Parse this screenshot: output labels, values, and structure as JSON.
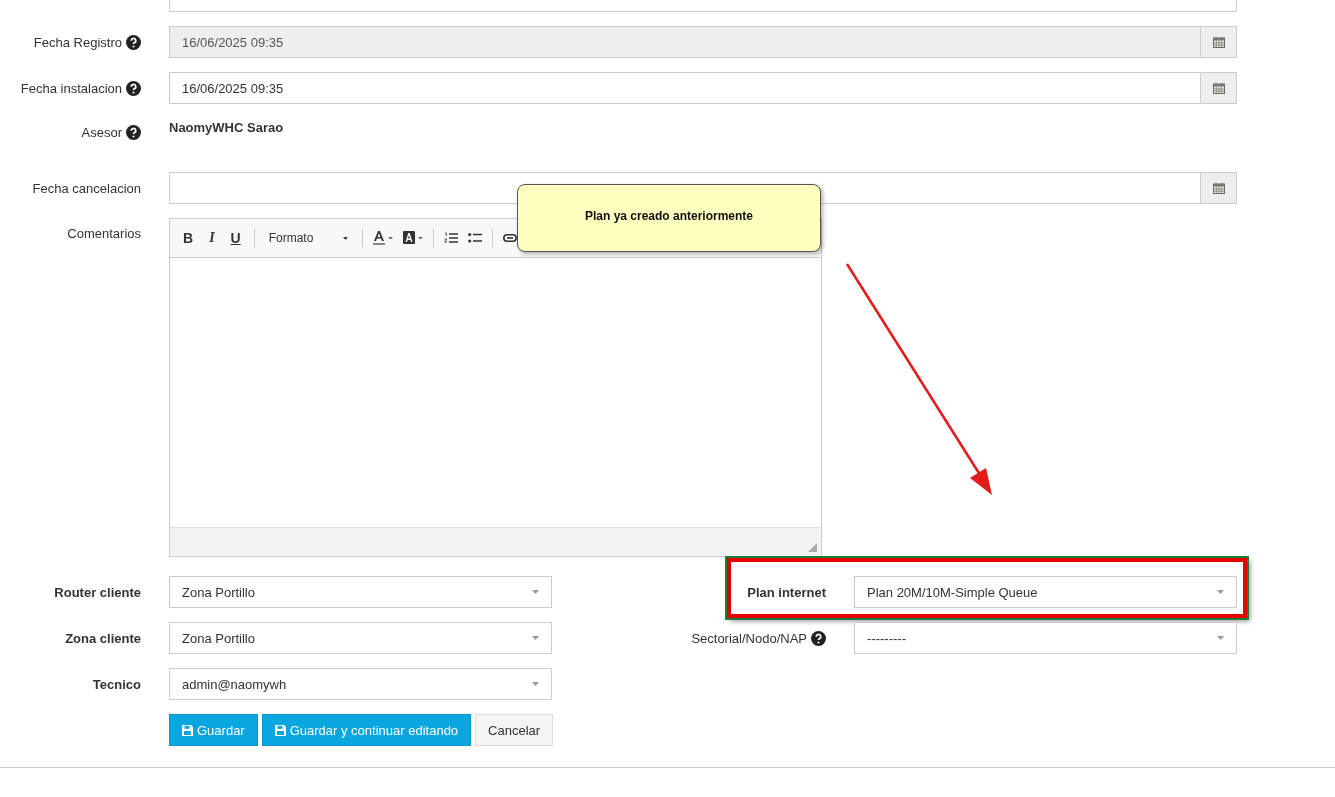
{
  "fields": [
    {
      "label": "Fecha Registro",
      "help": true,
      "kind": "date",
      "value": "16/06/2025 09:35",
      "disabled": true
    },
    {
      "label": "Fecha instalacion",
      "help": true,
      "kind": "date",
      "value": "16/06/2025 09:35",
      "disabled": false
    },
    {
      "label": "Asesor",
      "help": true,
      "kind": "static",
      "value": "NaomyWHC Sarao"
    },
    {
      "label": "Fecha cancelacion",
      "help": false,
      "kind": "date",
      "disabled": false
    },
    {
      "label": "Comentarios",
      "help": false,
      "kind": "editor",
      "toolbar": [
        "B",
        "I",
        "U"
      ],
      "format": "Formato"
    }
  ],
  "selects": [
    [
      {
        "label": "Router cliente",
        "required": true,
        "help": false,
        "value": "Zona Portillo"
      },
      {
        "label": "Plan internet",
        "required": true,
        "help": false,
        "value": "Plan 20M/10M-Simple Queue",
        "highlighted": true
      }
    ],
    [
      {
        "label": "Zona cliente",
        "required": true,
        "help": false,
        "value": "Zona Portillo"
      },
      {
        "label": "Sectorial/Nodo/NAP",
        "required": false,
        "help": true,
        "value": "---------",
        "highlighted": false
      }
    ],
    [
      {
        "label": "Tecnico",
        "required": true,
        "help": false,
        "value": "admin@naomywh"
      }
    ]
  ],
  "buttons": [
    {
      "label": "Guardar",
      "kind": "primary"
    },
    {
      "label": "Guardar y continuar editando",
      "kind": "primary"
    },
    {
      "label": "Cancelar",
      "kind": "default"
    }
  ],
  "note": {
    "text": "Plan ya creado anteriormente"
  }
}
